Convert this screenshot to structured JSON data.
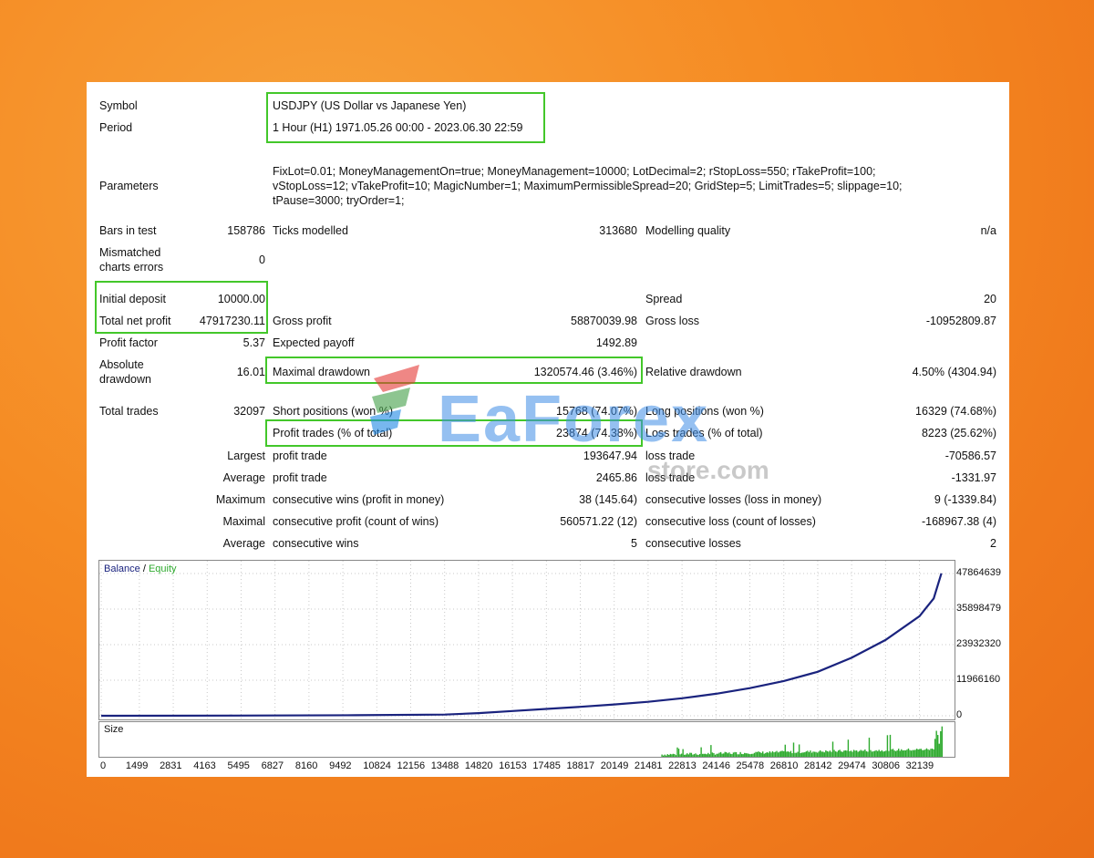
{
  "symbol": {
    "label": "Symbol",
    "value": "USDJPY (US Dollar vs Japanese Yen)"
  },
  "period": {
    "label": "Period",
    "value": "1 Hour (H1) 1971.05.26 00:00 - 2023.06.30 22:59"
  },
  "parameters": {
    "label": "Parameters",
    "lines": [
      "FixLot=0.01; MoneyManagementOn=true; MoneyManagement=10000; LotDecimal=2; rStopLoss=550; rTakeProfit=100;",
      "vStopLoss=12; vTakeProfit=10; MagicNumber=1; MaximumPermissibleSpread=20; GridStep=5; LimitTrades=5; slippage=10;",
      "tPause=3000; tryOrder=1;"
    ]
  },
  "stats": {
    "bars_in_test": {
      "label": "Bars in test",
      "value": "158786"
    },
    "ticks_modelled": {
      "label": "Ticks modelled",
      "value": "313680"
    },
    "modelling_quality": {
      "label": "Modelling quality",
      "value": "n/a"
    },
    "mismatched": {
      "label1": "Mismatched",
      "label2": "charts errors",
      "value": "0"
    },
    "initial_deposit": {
      "label": "Initial deposit",
      "value": "10000.00"
    },
    "spread": {
      "label": "Spread",
      "value": "20"
    },
    "total_net_profit": {
      "label": "Total net profit",
      "value": "47917230.11"
    },
    "gross_profit": {
      "label": "Gross profit",
      "value": "58870039.98"
    },
    "gross_loss": {
      "label": "Gross loss",
      "value": "-10952809.87"
    },
    "profit_factor": {
      "label": "Profit factor",
      "value": "5.37"
    },
    "expected_payoff": {
      "label": "Expected payoff",
      "value": "1492.89"
    },
    "absolute_drawdown": {
      "label1": "Absolute",
      "label2": "drawdown",
      "value": "16.01"
    },
    "maximal_drawdown": {
      "label": "Maximal drawdown",
      "value": "1320574.46 (3.46%)"
    },
    "relative_drawdown": {
      "label": "Relative drawdown",
      "value": "4.50% (4304.94)"
    },
    "total_trades": {
      "label": "Total trades",
      "value": "32097"
    },
    "short_positions": {
      "label": "Short positions (won %)",
      "value": "15768 (74.07%)"
    },
    "long_positions": {
      "label": "Long positions (won %)",
      "value": "16329 (74.68%)"
    },
    "profit_trades": {
      "label": "Profit trades (% of total)",
      "value": "23874 (74.38%)"
    },
    "loss_trades": {
      "label": "Loss trades (% of total)",
      "value": "8223 (25.62%)"
    },
    "largest": {
      "label": "Largest",
      "profit_label": "profit trade",
      "profit_value": "193647.94",
      "loss_label": "loss trade",
      "loss_value": "-70586.57"
    },
    "average": {
      "label": "Average",
      "profit_label": "profit trade",
      "profit_value": "2465.86",
      "loss_label": "loss trade",
      "loss_value": "-1331.97"
    },
    "maximum": {
      "label": "Maximum",
      "profit_label": "consecutive wins (profit in money)",
      "profit_value": "38 (145.64)",
      "loss_label": "consecutive losses (loss in money)",
      "loss_value": "9 (-1339.84)"
    },
    "maximal": {
      "label": "Maximal",
      "profit_label": "consecutive profit (count of wins)",
      "profit_value": "560571.22 (12)",
      "loss_label": "consecutive loss (count of losses)",
      "loss_value": "-168967.38 (4)"
    },
    "average_consec": {
      "label": "Average",
      "profit_label": "consecutive wins",
      "profit_value": "5",
      "loss_label": "consecutive losses",
      "loss_value": "2"
    }
  },
  "watermark": {
    "brand": "EaForex",
    "sub": "store.com"
  },
  "chart_data": {
    "type": "line",
    "legend": {
      "balance": "Balance",
      "separator": " / ",
      "equity": "Equity"
    },
    "balance_color": "#1a237e",
    "equity_color": "#2eaa2e",
    "y_ticks": [
      "47864639",
      "35898479",
      "23932320",
      "11966160",
      "0"
    ],
    "x_ticks": [
      "0",
      "1499",
      "2831",
      "4163",
      "5495",
      "6827",
      "8160",
      "9492",
      "10824",
      "12156",
      "13488",
      "14820",
      "16153",
      "17485",
      "18817",
      "20149",
      "21481",
      "22813",
      "24146",
      "25478",
      "26810",
      "28142",
      "29474",
      "30806",
      "32139"
    ],
    "ylim": [
      0,
      50000000
    ],
    "xlim": [
      0,
      33300
    ],
    "series": [
      {
        "name": "Balance",
        "x": [
          0,
          5000,
          10000,
          13500,
          14820,
          16153,
          17485,
          18817,
          20149,
          21481,
          22813,
          24146,
          25478,
          26810,
          28142,
          29474,
          30806,
          32139,
          32700,
          33000
        ],
        "y": [
          10000,
          60000,
          180000,
          400000,
          900000,
          1600000,
          2300000,
          3000000,
          3800000,
          4700000,
          5900000,
          7400000,
          9300000,
          11700000,
          14800000,
          19500000,
          25500000,
          33500000,
          39500000,
          47917230
        ]
      }
    ],
    "size_panel": {
      "label": "Size",
      "color": "#2eaa2e"
    }
  }
}
